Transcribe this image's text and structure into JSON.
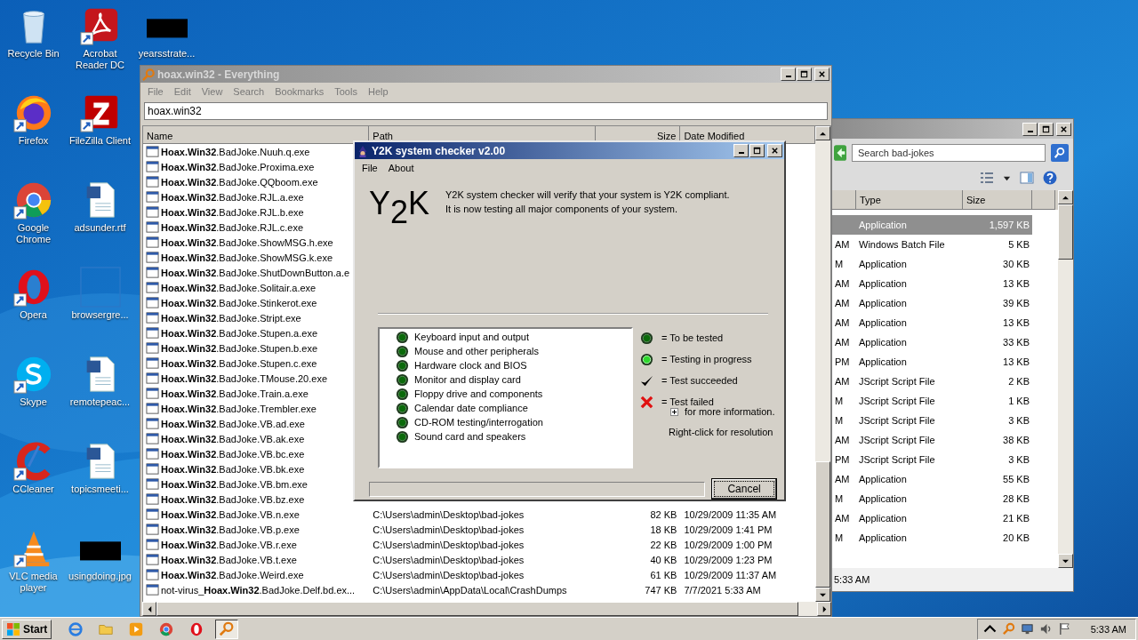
{
  "desktop": {
    "columns": [
      {
        "icons": [
          {
            "label": "Recycle Bin",
            "kind": "recycle",
            "shortcut": false
          },
          {
            "label": "Firefox",
            "kind": "firefox",
            "shortcut": true
          },
          {
            "label": "Google Chrome",
            "kind": "chrome",
            "shortcut": true
          },
          {
            "label": "Opera",
            "kind": "opera",
            "shortcut": true
          },
          {
            "label": "Skype",
            "kind": "skype",
            "shortcut": true
          },
          {
            "label": "CCleaner",
            "kind": "ccleaner",
            "shortcut": true
          },
          {
            "label": "VLC media player",
            "kind": "vlc",
            "shortcut": true
          }
        ]
      },
      {
        "icons": [
          {
            "label": "Acrobat Reader DC",
            "kind": "pdf",
            "shortcut": true
          },
          {
            "label": "FileZilla Client",
            "kind": "filezilla",
            "shortcut": true
          },
          {
            "label": "adsunder.rtf",
            "kind": "word",
            "shortcut": false
          },
          {
            "label": "browsergre...",
            "kind": "blank",
            "shortcut": false
          },
          {
            "label": "remotepeac...",
            "kind": "word",
            "shortcut": false
          },
          {
            "label": "topicsmeeti...",
            "kind": "word",
            "shortcut": false
          },
          {
            "label": "usingdoing.jpg",
            "kind": "thumbnail",
            "shortcut": false
          }
        ]
      },
      {
        "icons": [
          {
            "label": "yearsstrate...",
            "kind": "thumbnail",
            "shortcut": false
          }
        ]
      }
    ]
  },
  "explorer": {
    "search": {
      "placeholder": "Search bad-jokes"
    },
    "columns": [
      "Type",
      "Size"
    ],
    "rows": [
      {
        "date_tail": "",
        "type": "Application",
        "size": "1,597 KB",
        "selected": true
      },
      {
        "date_tail": "AM",
        "type": "Windows Batch File",
        "size": "5 KB",
        "selected": false
      },
      {
        "date_tail": "M",
        "type": "Application",
        "size": "30 KB",
        "selected": false
      },
      {
        "date_tail": "AM",
        "type": "Application",
        "size": "13 KB",
        "selected": false
      },
      {
        "date_tail": "AM",
        "type": "Application",
        "size": "39 KB",
        "selected": false
      },
      {
        "date_tail": "AM",
        "type": "Application",
        "size": "13 KB",
        "selected": false
      },
      {
        "date_tail": "AM",
        "type": "Application",
        "size": "33 KB",
        "selected": false
      },
      {
        "date_tail": "PM",
        "type": "Application",
        "size": "13 KB",
        "selected": false
      },
      {
        "date_tail": "AM",
        "type": "JScript Script File",
        "size": "2 KB",
        "selected": false
      },
      {
        "date_tail": "M",
        "type": "JScript Script File",
        "size": "1 KB",
        "selected": false
      },
      {
        "date_tail": "M",
        "type": "JScript Script File",
        "size": "3 KB",
        "selected": false
      },
      {
        "date_tail": "AM",
        "type": "JScript Script File",
        "size": "38 KB",
        "selected": false
      },
      {
        "date_tail": "PM",
        "type": "JScript Script File",
        "size": "3 KB",
        "selected": false
      },
      {
        "date_tail": "AM",
        "type": "Application",
        "size": "55 KB",
        "selected": false
      },
      {
        "date_tail": "M",
        "type": "Application",
        "size": "28 KB",
        "selected": false
      },
      {
        "date_tail": "AM",
        "type": "Application",
        "size": "21 KB",
        "selected": false
      },
      {
        "date_tail": "M",
        "type": "Application",
        "size": "20 KB",
        "selected": false
      }
    ],
    "status": "5:33 AM"
  },
  "everything": {
    "title": "hoax.win32 - Everything",
    "menu": [
      "File",
      "Edit",
      "View",
      "Search",
      "Bookmarks",
      "Tools",
      "Help"
    ],
    "search": {
      "value": "hoax.win32"
    },
    "columns": [
      "Name",
      "Path",
      "Size",
      "Date Modified"
    ],
    "rows": [
      {
        "name": "**Hoax.Win32**.BadJoke.Nuuh.q.exe"
      },
      {
        "name": "**Hoax.Win32**.BadJoke.Proxima.exe"
      },
      {
        "name": "**Hoax.Win32**.BadJoke.QQboom.exe"
      },
      {
        "name": "**Hoax.Win32**.BadJoke.RJL.a.exe"
      },
      {
        "name": "**Hoax.Win32**.BadJoke.RJL.b.exe"
      },
      {
        "name": "**Hoax.Win32**.BadJoke.RJL.c.exe"
      },
      {
        "name": "**Hoax.Win32**.BadJoke.ShowMSG.h.exe"
      },
      {
        "name": "**Hoax.Win32**.BadJoke.ShowMSG.k.exe"
      },
      {
        "name": "**Hoax.Win32**.BadJoke.ShutDownButton.a.e"
      },
      {
        "name": "**Hoax.Win32**.BadJoke.Solitair.a.exe"
      },
      {
        "name": "**Hoax.Win32**.BadJoke.Stinkerot.exe"
      },
      {
        "name": "**Hoax.Win32**.BadJoke.Stript.exe"
      },
      {
        "name": "**Hoax.Win32**.BadJoke.Stupen.a.exe"
      },
      {
        "name": "**Hoax.Win32**.BadJoke.Stupen.b.exe"
      },
      {
        "name": "**Hoax.Win32**.BadJoke.Stupen.c.exe"
      },
      {
        "name": "**Hoax.Win32**.BadJoke.TMouse.20.exe"
      },
      {
        "name": "**Hoax.Win32**.BadJoke.Train.a.exe"
      },
      {
        "name": "**Hoax.Win32**.BadJoke.Trembler.exe"
      },
      {
        "name": "**Hoax.Win32**.BadJoke.VB.ad.exe"
      },
      {
        "name": "**Hoax.Win32**.BadJoke.VB.ak.exe"
      },
      {
        "name": "**Hoax.Win32**.BadJoke.VB.bc.exe"
      },
      {
        "name": "**Hoax.Win32**.BadJoke.VB.bk.exe"
      },
      {
        "name": "**Hoax.Win32**.BadJoke.VB.bm.exe"
      },
      {
        "name": "**Hoax.Win32**.BadJoke.VB.bz.exe"
      },
      {
        "name": "**Hoax.Win32**.BadJoke.VB.n.exe",
        "path": "C:\\Users\\admin\\Desktop\\bad-jokes",
        "size": "82 KB",
        "date": "10/29/2009 11:35 AM"
      },
      {
        "name": "**Hoax.Win32**.BadJoke.VB.p.exe",
        "path": "C:\\Users\\admin\\Desktop\\bad-jokes",
        "size": "18 KB",
        "date": "10/29/2009 1:41 PM"
      },
      {
        "name": "**Hoax.Win32**.BadJoke.VB.r.exe",
        "path": "C:\\Users\\admin\\Desktop\\bad-jokes",
        "size": "22 KB",
        "date": "10/29/2009 1:00 PM"
      },
      {
        "name": "**Hoax.Win32**.BadJoke.VB.t.exe",
        "path": "C:\\Users\\admin\\Desktop\\bad-jokes",
        "size": "40 KB",
        "date": "10/29/2009 1:23 PM"
      },
      {
        "name": "**Hoax.Win32**.BadJoke.Weird.exe",
        "path": "C:\\Users\\admin\\Desktop\\bad-jokes",
        "size": "61 KB",
        "date": "10/29/2009 11:37 AM"
      },
      {
        "name": "not-virus_**Hoax.Win32**.BadJoke.Delf.bd.ex...",
        "path": "C:\\Users\\admin\\AppData\\Local\\CrashDumps",
        "size": "747 KB",
        "date": "7/7/2021 5:33 AM"
      }
    ]
  },
  "dialog": {
    "title": "Y2K system checker v2.00",
    "menu": [
      "File",
      "About"
    ],
    "logo": "Y$_{2}$K",
    "description": [
      "Y2K system checker will verify that your system is Y2K compliant.",
      "It is now testing all major components of your system."
    ],
    "tests": [
      {
        "label": "Keyboard input and output",
        "kind": "pending"
      },
      {
        "label": "Mouse and other peripherals",
        "kind": "pending"
      },
      {
        "label": "Hardware clock and BIOS",
        "kind": "pending"
      },
      {
        "label": "Monitor and display card",
        "kind": "pending"
      },
      {
        "label": "Floppy drive and components",
        "kind": "pending"
      },
      {
        "label": "Calendar date compliance",
        "kind": "pending"
      },
      {
        "label": "CD-ROM testing/interrogation",
        "kind": "pending"
      },
      {
        "label": "Sound card and speakers",
        "kind": "pending"
      }
    ],
    "legend": [
      {
        "label": "= To be tested",
        "kind": "pending"
      },
      {
        "label": "= Testing in progress",
        "kind": "testing"
      },
      {
        "label": "= Test succeeded",
        "kind": "passed"
      },
      {
        "label": "= Test failed",
        "kind": "failed"
      }
    ],
    "more_info": "for more information.",
    "hint": "Right-click for resolution",
    "progress": {
      "level": 0
    },
    "cancel": "Cancel"
  },
  "taskbar": {
    "start": "Start",
    "apps": [
      {
        "kind": "ie",
        "active": false
      },
      {
        "kind": "folder",
        "active": false
      },
      {
        "kind": "media",
        "active": false
      },
      {
        "kind": "chrome",
        "active": false
      },
      {
        "kind": "opera",
        "active": false
      },
      {
        "kind": "search",
        "active": true
      }
    ],
    "clock": "5:33 AM"
  }
}
